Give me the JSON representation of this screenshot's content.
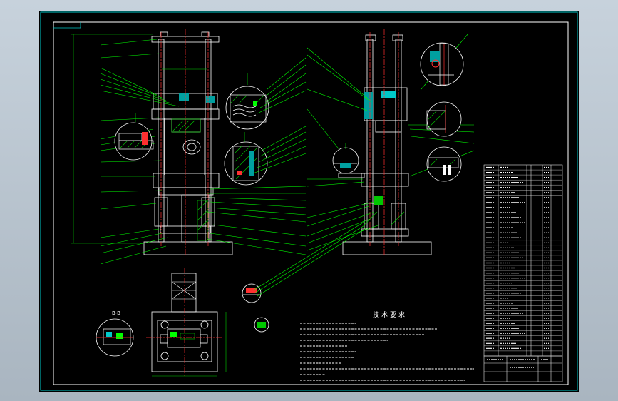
{
  "drawing": {
    "tech_requirements_title": "技术要求",
    "view_label_b": "B",
    "view_label_bb": "B-B",
    "colors": {
      "sheet": "#000000",
      "frame": "#ffffff",
      "frame_inner": "#00c8c8",
      "geometry": "#ffffff",
      "centerline": "#ff3030",
      "leader": "#00ff00",
      "hatch": "#00c800",
      "dimension": "#00d000",
      "parts_text": "#e0e0e0"
    }
  }
}
